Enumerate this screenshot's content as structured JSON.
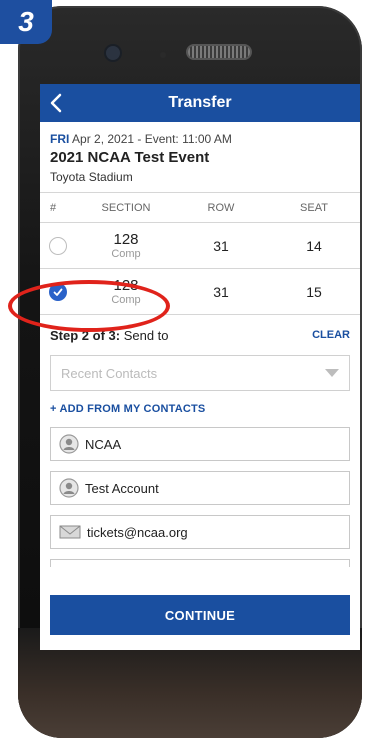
{
  "step_badge": "3",
  "nav": {
    "title": "Transfer"
  },
  "event": {
    "day": "FRI",
    "date_time": "Apr 2, 2021 - Event: 11:00 AM",
    "name": "2021 NCAA Test Event",
    "venue": "Toyota Stadium"
  },
  "table": {
    "headers": {
      "hash": "#",
      "section": "SECTION",
      "row": "ROW",
      "seat": "SEAT"
    },
    "rows": [
      {
        "section": "128",
        "section_sub": "Comp",
        "row": "31",
        "seat": "14",
        "selected": false
      },
      {
        "section": "128",
        "section_sub": "Comp",
        "row": "31",
        "seat": "15",
        "selected": true
      }
    ]
  },
  "step": {
    "bold": "Step 2 of 3:",
    "rest": "Send to",
    "clear": "CLEAR"
  },
  "dropdown": {
    "placeholder": "Recent Contacts"
  },
  "add_contacts": "+ ADD FROM MY CONTACTS",
  "contacts": [
    {
      "name": "NCAA",
      "icon": "person-icon"
    },
    {
      "name": "Test Account",
      "icon": "person-icon"
    },
    {
      "name": "tickets@ncaa.org",
      "icon": "envelope-icon"
    }
  ],
  "continue_label": "CONTINUE",
  "colors": {
    "primary": "#1a4fa0",
    "annotation": "#e0231b",
    "checked": "#2a62c9"
  }
}
